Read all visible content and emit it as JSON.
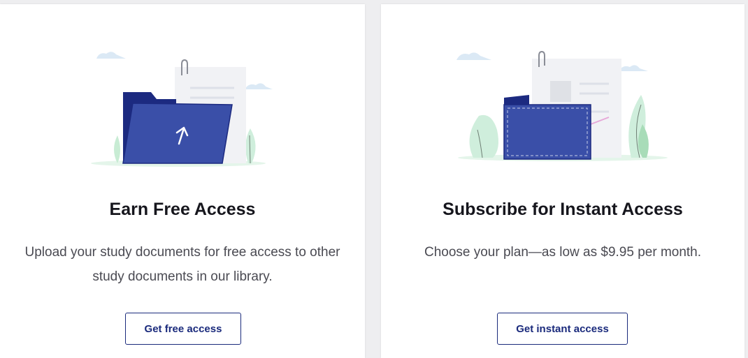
{
  "free_card": {
    "title": "Earn Free Access",
    "description": "Upload your study documents for free access to other study documents in our library.",
    "button_label": "Get free access",
    "icon": "folder-upload-icon"
  },
  "instant_card": {
    "title": "Subscribe for Instant Access",
    "description": "Choose your plan—as low as $9.95 per month.",
    "button_label": "Get instant access",
    "icon": "wallet-icon"
  },
  "colors": {
    "brand_navy": "#1a2a7c",
    "folder_blue": "#3a4fa8",
    "plant_green": "#c8ecd4"
  }
}
